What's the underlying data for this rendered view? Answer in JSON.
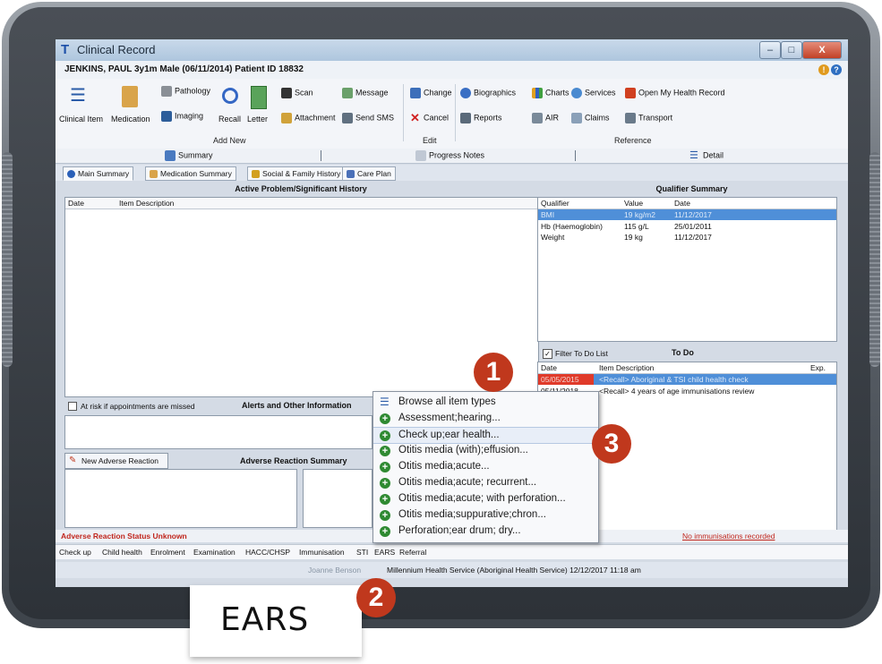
{
  "window": {
    "title": "Clinical Record",
    "min": "–",
    "max": "□",
    "close": "X"
  },
  "patient": {
    "header": "JENKINS, PAUL 3y1m Male (06/11/2014) Patient ID 18832"
  },
  "toolbar": {
    "clinical_item": "Clinical Item",
    "medication": "Medication",
    "pathology": "Pathology",
    "imaging": "Imaging",
    "recall": "Recall",
    "letter": "Letter",
    "scan": "Scan",
    "attachment": "Attachment",
    "message": "Message",
    "send_sms": "Send SMS",
    "change": "Change",
    "cancel": "Cancel",
    "biographics": "Biographics",
    "reports": "Reports",
    "charts": "Charts",
    "air": "AIR",
    "services": "Services",
    "claims": "Claims",
    "open_my_health_record": "Open My Health Record",
    "transport": "Transport",
    "group_add_new": "Add New",
    "group_edit": "Edit",
    "group_reference": "Reference"
  },
  "views": {
    "summary": "Summary",
    "progress_notes": "Progress Notes",
    "detail": "Detail"
  },
  "tabs": [
    "Main Summary",
    "Medication Summary",
    "Social & Family History",
    "Care Plan"
  ],
  "active_problems": {
    "title": "Active Problem/Significant History",
    "col_date": "Date",
    "col_desc": "Item Description"
  },
  "qualifier": {
    "title": "Qualifier Summary",
    "cols": [
      "Qualifier",
      "Value",
      "Date"
    ],
    "rows": [
      [
        "BMI",
        "19 kg/m2",
        "11/12/2017"
      ],
      [
        "Hb (Haemoglobin)",
        "115 g/L",
        "25/01/2011"
      ],
      [
        "Weight",
        "19 kg",
        "11/12/2017"
      ]
    ]
  },
  "todo": {
    "filter_label": "Filter To Do List",
    "title": "To Do",
    "cols": [
      "Date",
      "Item Description",
      "Exp."
    ],
    "rows": [
      [
        "05/05/2015",
        "<Recall> Aboriginal & TSI child health check"
      ],
      [
        "05/11/2018",
        "<Recall> 4 years of age immunisations review"
      ]
    ]
  },
  "alerts": {
    "checkbox_label": "At risk if appointments are missed",
    "title": "Alerts and Other Information"
  },
  "adverse": {
    "new_button": "New Adverse Reaction",
    "title": "Adverse Reaction Summary",
    "status": "Adverse Reaction Status Unknown",
    "immunisations": "No immunisations recorded"
  },
  "menu": {
    "items": [
      "Browse all item types",
      "Assessment;hearing...",
      "Check up;ear health...",
      "Otitis media (with);effusion...",
      "Otitis media;acute...",
      "Otitis media;acute; recurrent...",
      "Otitis media;acute; with perforation...",
      "Otitis media;suppurative;chron...",
      "Perforation;ear drum; dry..."
    ]
  },
  "quicklinks": [
    "Check up",
    "Child health",
    "Enrolment",
    "Examination",
    "HACC/CHSP",
    "Immunisation",
    "STI",
    "EARS",
    "Referral"
  ],
  "statusbar": {
    "user": "Joanne Benson",
    "service": "Millennium Health Service (Aboriginal Health Service) 12/12/2017 11:18 am"
  },
  "callouts": {
    "one": "1",
    "two": "2",
    "three": "3",
    "ears": "EARS"
  },
  "colors": {
    "accent": "#c0381d",
    "selection": "#4f8fd8",
    "menu_plus": "#2f8a32"
  }
}
